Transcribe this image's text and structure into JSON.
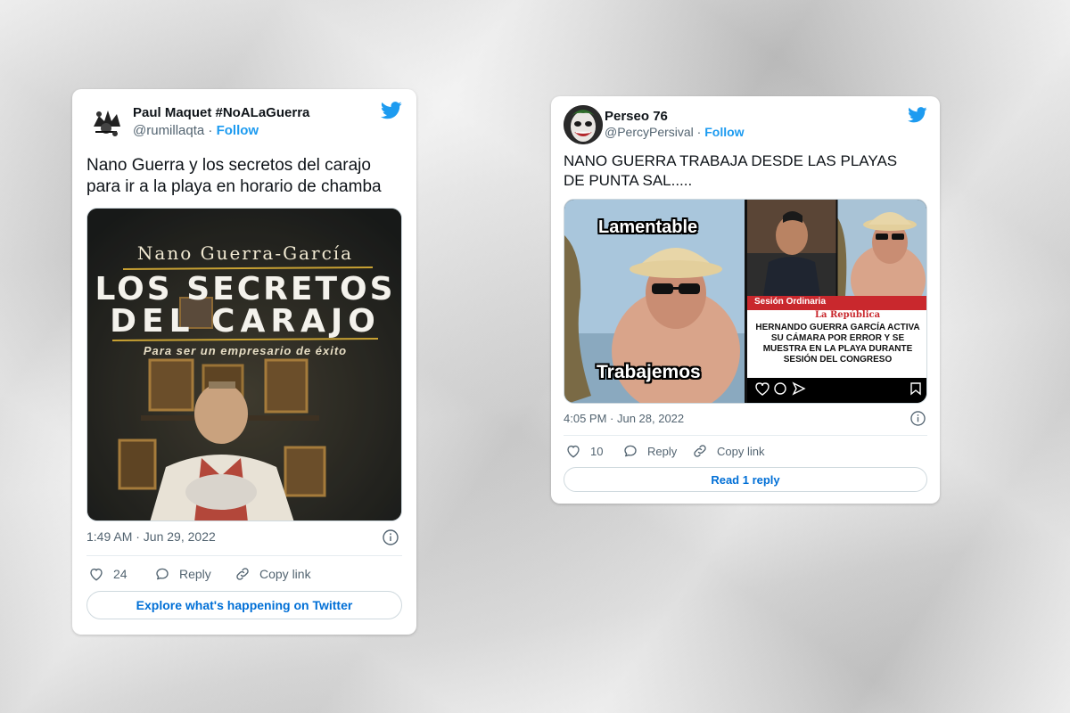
{
  "tweets": [
    {
      "author_name": "Paul Maquet #NoALaGuerra",
      "handle": "@rumillaqta",
      "separator": " · ",
      "follow_label": "Follow",
      "text": "Nano Guerra y los secretos del carajo para ir a la playa en horario de chamba",
      "media": {
        "book_author": "Nano Guerra-García",
        "book_title_line1": "LOS SECRETOS",
        "book_title_line2": "DEL CARAJO",
        "book_subtitle": "Para ser un empresario de éxito"
      },
      "timestamp": "1:49 AM · Jun 29, 2022",
      "likes": "24",
      "reply_label": "Reply",
      "copy_label": "Copy link",
      "cta_label": "Explore what's happening on Twitter"
    },
    {
      "author_name": "Perseo 76",
      "handle": "@PercyPersival",
      "separator": " · ",
      "follow_label": "Follow",
      "text": "NANO GUERRA TRABAJA DESDE LAS PLAYAS DE PUNTA SAL.....",
      "media": {
        "caption_top": "Lamentable",
        "caption_bottom": "Trabajemos",
        "news_tag": "Sesión Ordinaria",
        "news_brand": "La República",
        "news_headline": "HERNANDO GUERRA GARCÍA ACTIVA SU CÁMARA POR ERROR Y SE MUESTRA EN LA PLAYA DURANTE SESIÓN DEL CONGRESO"
      },
      "timestamp": "4:05 PM · Jun 28, 2022",
      "likes": "10",
      "reply_label": "Reply",
      "copy_label": "Copy link",
      "cta_label": "Read 1 reply"
    }
  ],
  "colors": {
    "accent": "#1d9bf0",
    "cta_text": "#006fd6",
    "muted": "#536471",
    "text": "#0f1419"
  },
  "icons": [
    "twitter-bird-icon",
    "info-icon",
    "heart-icon",
    "reply-icon",
    "link-icon"
  ]
}
